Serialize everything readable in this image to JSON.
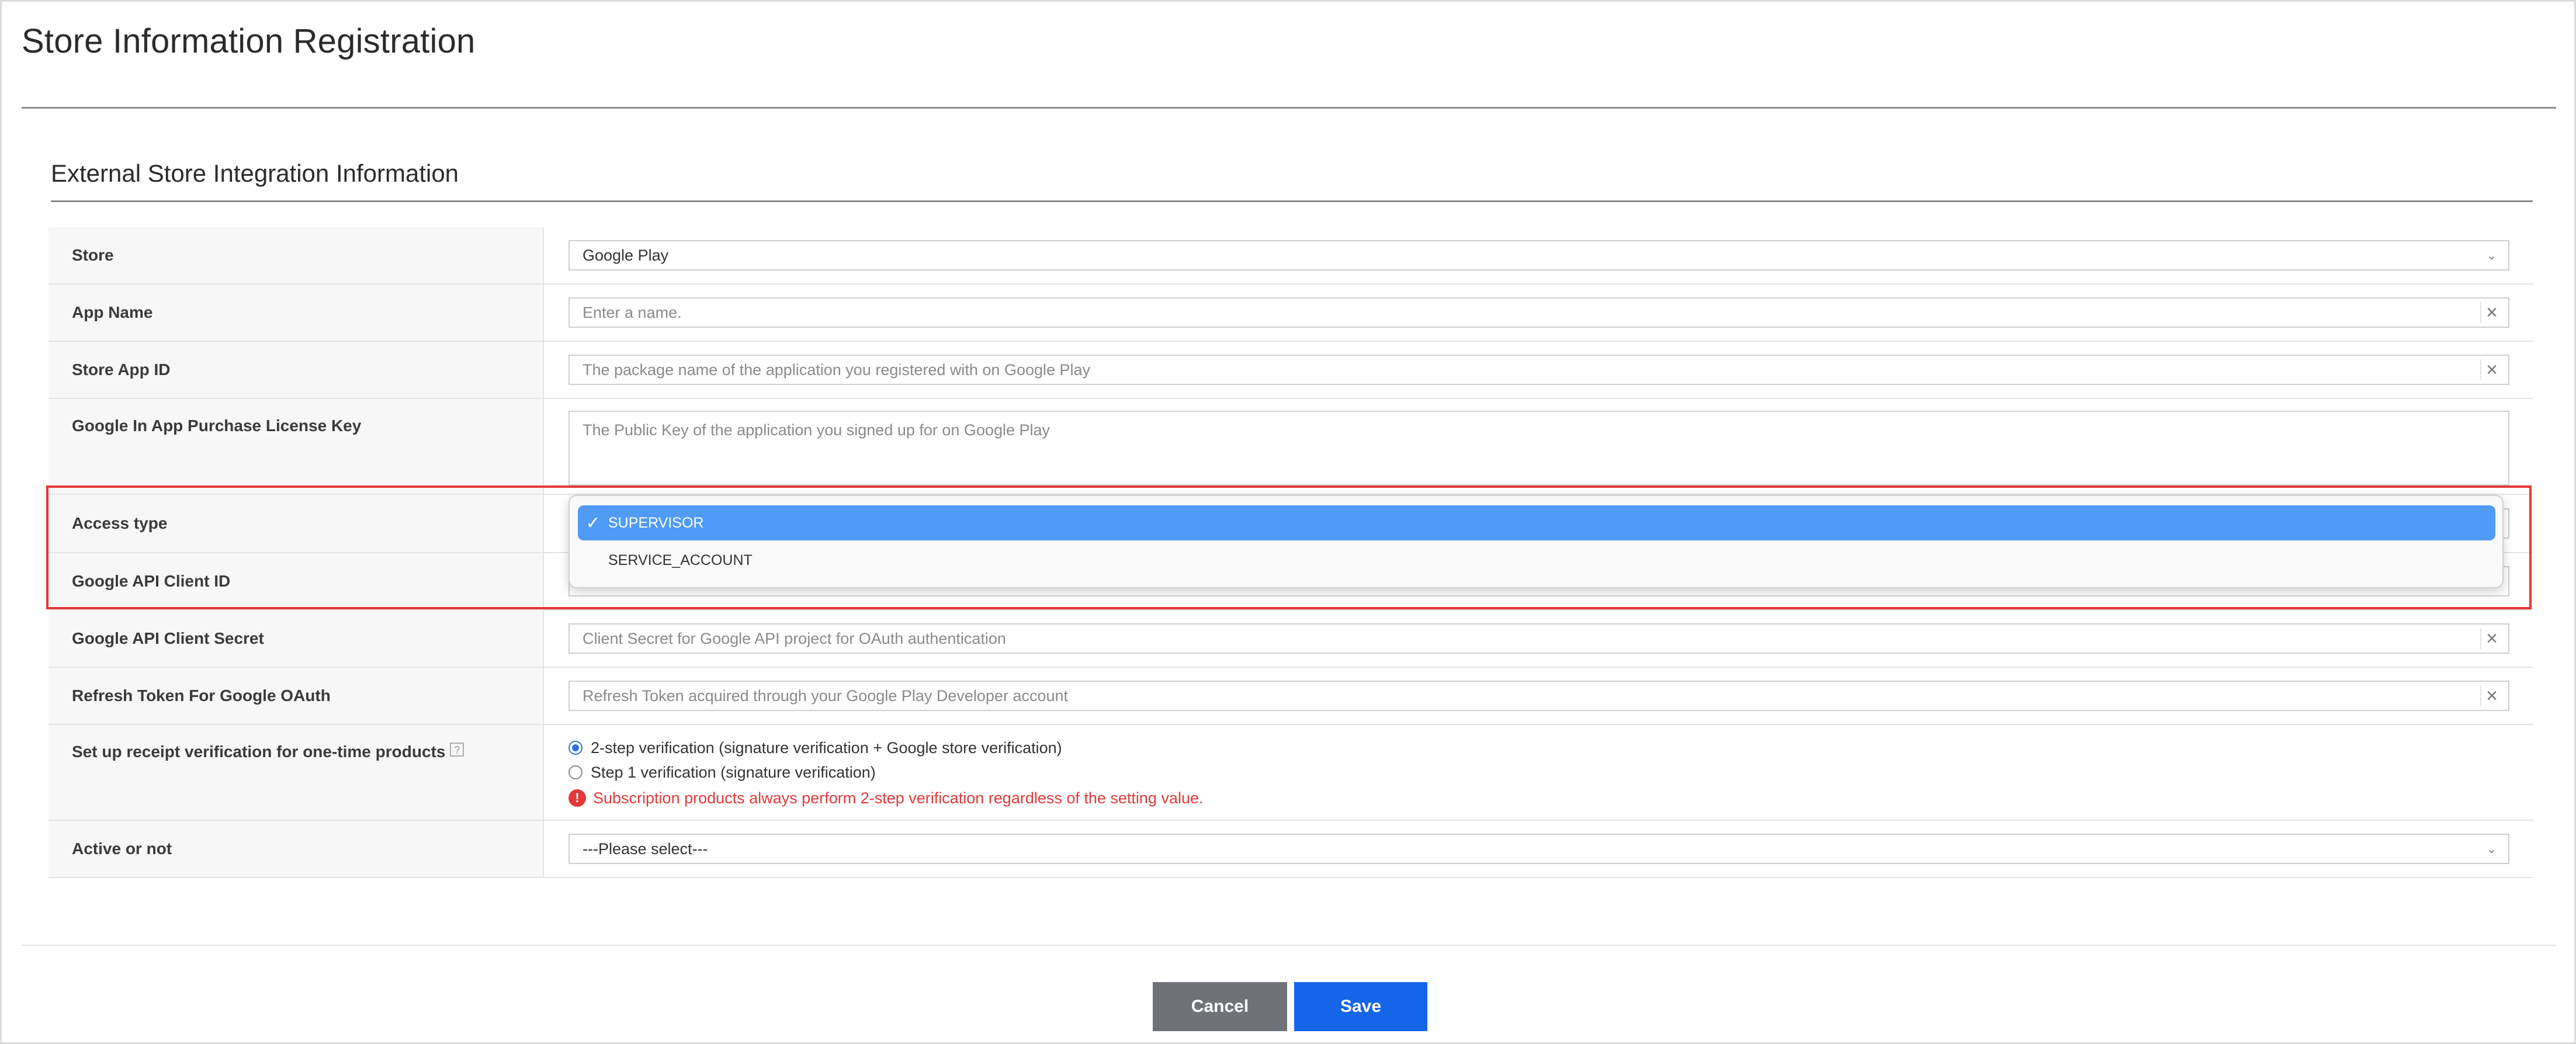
{
  "page": {
    "title": "Store Information Registration"
  },
  "section": {
    "title": "External Store Integration Information"
  },
  "fields": {
    "store": {
      "label": "Store",
      "value": "Google Play"
    },
    "app_name": {
      "label": "App Name",
      "placeholder": "Enter a name."
    },
    "store_app_id": {
      "label": "Store App ID",
      "placeholder": "The package name of the application you registered with on Google Play"
    },
    "license_key": {
      "label": "Google In App Purchase License Key",
      "placeholder": "The Public Key of the application you signed up for on Google Play"
    },
    "access_type": {
      "label": "Access type"
    },
    "client_id": {
      "label": "Google API Client ID"
    },
    "client_secret": {
      "label": "Google API Client Secret",
      "placeholder": "Client Secret for Google API project for OAuth authentication"
    },
    "refresh_token": {
      "label": "Refresh Token For Google OAuth",
      "placeholder": "Refresh Token acquired through your Google Play Developer account"
    },
    "receipt_verification": {
      "label": "Set up receipt verification for one-time products",
      "help": "?",
      "options": [
        "2-step verification (signature verification + Google store verification)",
        "Step 1 verification (signature verification)"
      ],
      "selected_index": 0,
      "warning": "Subscription products always perform 2-step verification regardless of the setting value."
    },
    "active": {
      "label": "Active or not",
      "value": "---Please select---"
    }
  },
  "dropdown": {
    "options": [
      "SUPERVISOR",
      "SERVICE_ACCOUNT"
    ],
    "selected_index": 0,
    "check": "✓"
  },
  "icons": {
    "clear": "×",
    "chevron": "⌄",
    "warning": "!"
  },
  "buttons": {
    "cancel": "Cancel",
    "save": "Save"
  },
  "colors": {
    "primary": "#1565e8",
    "cancel": "#6f7378",
    "highlight": "#e53935",
    "warning": "#e23a3a",
    "dropdown_selected": "#4f9bf6"
  }
}
